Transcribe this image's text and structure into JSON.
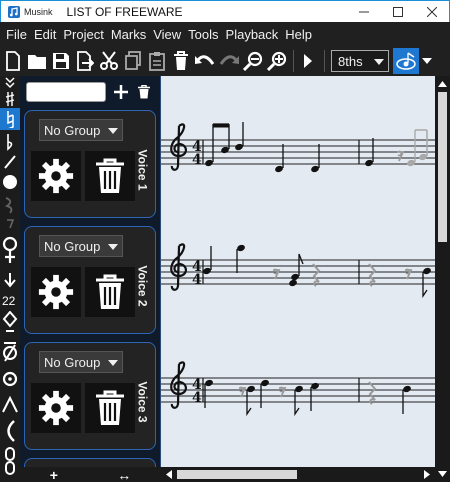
{
  "titlebar": {
    "app_name": "Musink",
    "document_title": "LIST OF FREEWARE",
    "minimize_icon": "minimize-icon",
    "maximize_icon": "maximize-icon",
    "close_icon": "close-icon"
  },
  "menubar": {
    "items": [
      "File",
      "Edit",
      "Project",
      "Marks",
      "View",
      "Tools",
      "Playback",
      "Help"
    ]
  },
  "toolbar": {
    "icons": [
      "new-file-icon",
      "open-folder-icon",
      "save-icon",
      "export-icon",
      "cut-icon",
      "copy-icon",
      "paste-icon",
      "delete-icon",
      "undo-icon",
      "redo-icon",
      "zoom-out-icon",
      "zoom-in-icon",
      "play-icon"
    ],
    "note_length": "8ths",
    "accent_color": "#1e78d0"
  },
  "toolstrip": {
    "tools": [
      "double-chevron-icon",
      "sharp-icon",
      "natural-icon",
      "flat-icon",
      "line-tool-icon",
      "note-head-icon",
      "rest-tool-icon",
      "female-symbol-icon",
      "tuplet-icon",
      "slash-icon",
      "accent-icon",
      "tie-icon"
    ]
  },
  "voices": {
    "search_value": "",
    "add_icon": "plus-icon",
    "delete_icon": "trash-icon",
    "list": [
      {
        "label": "Voice 1",
        "group": "No Group"
      },
      {
        "label": "Voice 2",
        "group": "No Group"
      },
      {
        "label": "Voice 3",
        "group": "No Group"
      }
    ],
    "bottom_add": "+",
    "bottom_resize": "↔"
  },
  "score": {
    "time_signature": {
      "top": "4",
      "bottom": "4"
    },
    "clef": "treble-clef"
  }
}
